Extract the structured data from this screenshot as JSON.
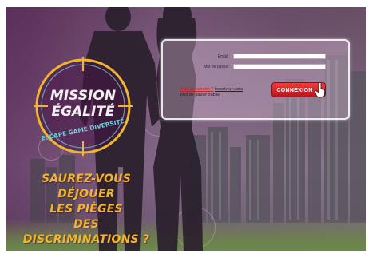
{
  "logo": {
    "line1": "MISSION",
    "line2": "ÉGALITÉ",
    "subtitle": "ESCAPE GAME DIVERSITÉ"
  },
  "tagline": {
    "line1": "SAUREZ-VOUS DÉJOUER",
    "line2": "LES PIÈGES",
    "line3": "DES DISCRIMINATIONS ?"
  },
  "login": {
    "email_label": "Email :",
    "email_value": "",
    "password_label": "Mot de passe :",
    "password_value": "",
    "no_account_text": "Pas de compte ?",
    "register_link": "Inscrivez-vous",
    "forgot_link": "Mot de passe oublié",
    "connect_button": "CONNEXION"
  },
  "colors": {
    "accent_gold": "#f0b62c",
    "button_red": "#d31b1b",
    "logo_teal": "#6fd0d8"
  },
  "icons": {
    "cursor": "hand-pointer-icon"
  }
}
